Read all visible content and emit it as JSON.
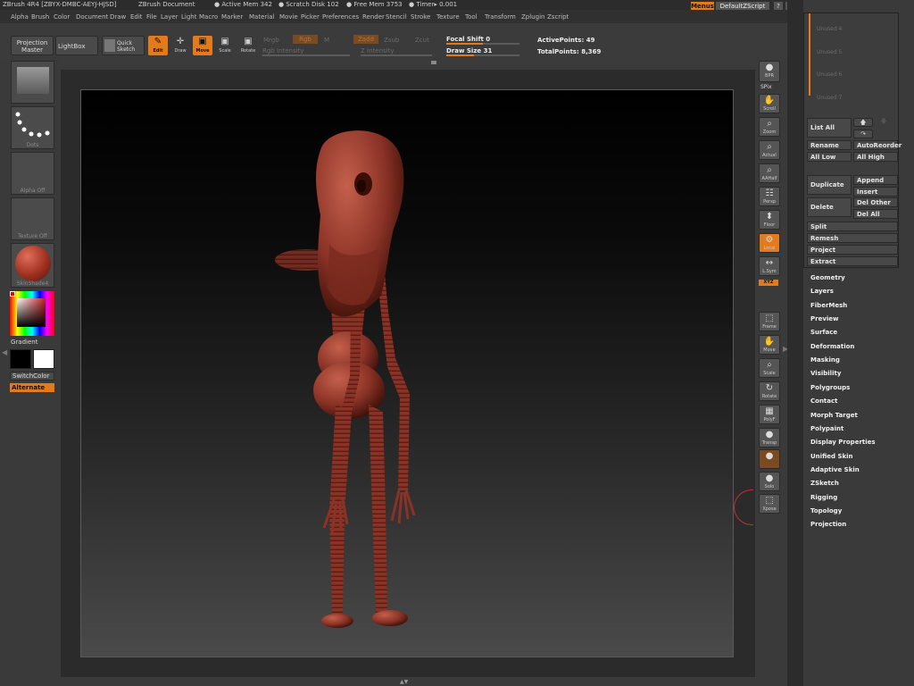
{
  "titlebar": {
    "app": "ZBrush 4R4 [ZBYX-DMBC-AEYJ-HJSD]",
    "doc": "ZBrush Document",
    "active_mem": "● Active Mem 342",
    "scratch": "● Scratch Disk 102",
    "free_mem": "● Free Mem 3753",
    "timer": "● Timer▸ 0.001",
    "menus_btn": "Menus",
    "script": "DefaultZScript"
  },
  "menu": [
    "Alpha",
    "Brush",
    "Color",
    "Document",
    "Draw",
    "Edit",
    "File",
    "Layer",
    "Light",
    "Macro",
    "Marker",
    "Material",
    "Movie",
    "Picker",
    "Preferences",
    "Render",
    "Stencil",
    "Stroke",
    "Texture",
    "Tool",
    "Transform",
    "Zplugin",
    "Zscript"
  ],
  "toolbar": {
    "projection_master": "Projection Master",
    "lightbox": "LightBox",
    "quick_sketch": "Quick Sketch",
    "edit": "Edit",
    "draw": "Draw",
    "move": "Move",
    "scale": "Scale",
    "rotate": "Rotate",
    "mrgb": "Mrgb",
    "rgb": "Rgb",
    "m": "M",
    "zadd": "Zadd",
    "zsub": "Zsub",
    "zcut": "Zcut",
    "rgb_intensity": "Rgb Intensity",
    "z_intensity": "Z Intensity",
    "focal_shift": "Focal Shift 0",
    "draw_size": "Draw Size 31",
    "active_points": "ActivePoints: 49",
    "total_points": "TotalPoints: 8,369"
  },
  "leftshelf": {
    "dots": "Dots",
    "alpha": "Alpha Off",
    "texture": "Texture Off",
    "material": "SkinShade4",
    "gradient": "Gradient",
    "switchcolor": "SwitchColor",
    "alternate": "Alternate"
  },
  "rightshelf": [
    {
      "icon": "bpr-icon",
      "label": "BPR",
      "glyph": "●"
    },
    {
      "icon": "scroll-icon",
      "label": "Scroll",
      "glyph": "✋"
    },
    {
      "icon": "zoom-icon",
      "label": "Zoom",
      "glyph": "⌕"
    },
    {
      "icon": "actual-icon",
      "label": "Actual",
      "glyph": "⌕"
    },
    {
      "icon": "aahalf-icon",
      "label": "AAHalf",
      "glyph": "⌕"
    },
    {
      "icon": "persp-icon",
      "label": "Persp",
      "glyph": "☷"
    },
    {
      "icon": "floor-icon",
      "label": "Floor",
      "glyph": "⬍"
    },
    {
      "icon": "local-icon",
      "label": "Local",
      "glyph": "⚙"
    },
    {
      "icon": "lsym-icon",
      "label": "L.Sym",
      "glyph": "↔"
    },
    {
      "icon": "frame-icon",
      "label": "Frame",
      "glyph": "⬚"
    },
    {
      "icon": "move-icon",
      "label": "Move",
      "glyph": "✋"
    },
    {
      "icon": "scale-icon",
      "label": "Scale",
      "glyph": "⌕"
    },
    {
      "icon": "rotate-icon",
      "label": "Rotate",
      "glyph": "↻"
    },
    {
      "icon": "polyf-icon",
      "label": "PolyF",
      "glyph": "▦"
    },
    {
      "icon": "transp-icon",
      "label": "Transp",
      "glyph": "●"
    },
    {
      "icon": "ghost-icon",
      "label": "",
      "glyph": "●"
    },
    {
      "icon": "solo-icon",
      "label": "Solo",
      "glyph": "●"
    },
    {
      "icon": "xpose-icon",
      "label": "Xpose",
      "glyph": "⬚"
    }
  ],
  "rightshelf_extra": {
    "spix": "SPix",
    "xyz": "XYZ"
  },
  "subtool": {
    "slots": [
      "Unused 4",
      "Unused 5",
      "Unused 6",
      "Unused 7"
    ],
    "list_all": "List All",
    "rename": "Rename",
    "autoreorder": "AutoReorder",
    "all_low": "All Low",
    "all_high": "All High",
    "duplicate": "Duplicate",
    "append": "Append",
    "insert": "Insert",
    "delete": "Delete",
    "del_other": "Del Other",
    "del_all": "Del All",
    "split": "Split",
    "remesh": "Remesh",
    "project": "Project",
    "extract": "Extract"
  },
  "palettes": [
    "Geometry",
    "Layers",
    "FiberMesh",
    "Preview",
    "Surface",
    "Deformation",
    "Masking",
    "Visibility",
    "Polygroups",
    "Contact",
    "Morph Target",
    "Polypaint",
    "Display Properties",
    "Unified Skin",
    "Adaptive Skin",
    "ZSketch",
    "Rigging",
    "Topology",
    "Projection"
  ],
  "colors": {
    "accent": "#e37b1c",
    "model": "#8a3226"
  }
}
